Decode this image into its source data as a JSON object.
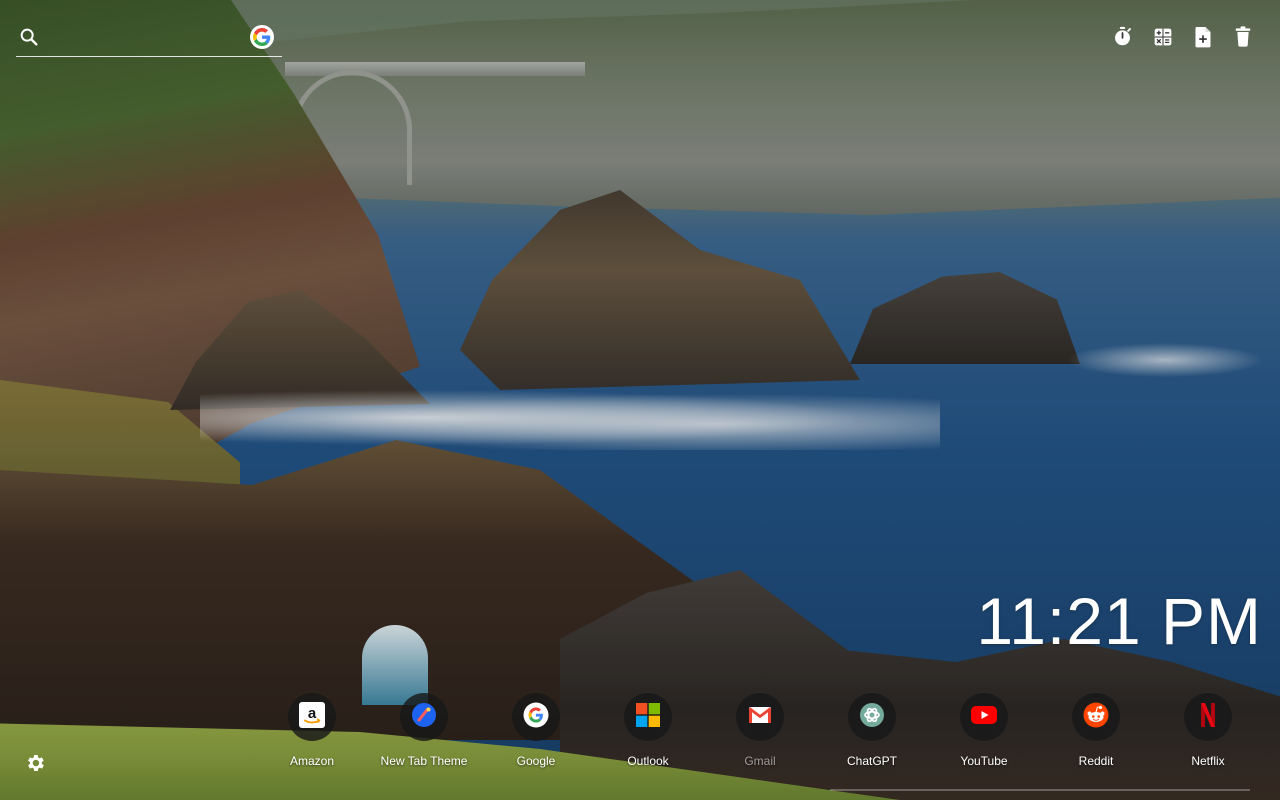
{
  "search": {
    "placeholder": "",
    "icon": "search-icon",
    "engine_icon": "google-icon"
  },
  "tools": [
    {
      "name": "timer",
      "icon": "stopwatch-icon"
    },
    {
      "name": "calculator",
      "icon": "calculator-icon"
    },
    {
      "name": "new-note",
      "icon": "note-add-icon"
    },
    {
      "name": "delete",
      "icon": "trash-icon"
    }
  ],
  "clock": {
    "time": "11:21 PM"
  },
  "shortcuts": [
    {
      "label": "Amazon",
      "icon": "amazon-icon"
    },
    {
      "label": "New Tab Theme",
      "icon": "new-tab-theme-icon"
    },
    {
      "label": "Google",
      "icon": "google-icon"
    },
    {
      "label": "Outlook",
      "icon": "microsoft-icon"
    },
    {
      "label": "Gmail",
      "icon": "gmail-icon"
    },
    {
      "label": "ChatGPT",
      "icon": "chatgpt-icon"
    },
    {
      "label": "YouTube",
      "icon": "youtube-icon"
    },
    {
      "label": "Reddit",
      "icon": "reddit-icon"
    },
    {
      "label": "Netflix",
      "icon": "netflix-icon"
    }
  ],
  "settings": {
    "icon": "gear-icon"
  },
  "colors": {
    "google_blue": "#4285F4",
    "google_red": "#EA4335",
    "google_yellow": "#FBBC05",
    "google_green": "#34A853",
    "youtube_red": "#FF0000",
    "reddit_orange": "#FF4500",
    "netflix_red": "#E50914",
    "new_tab_blue": "#1E63F0"
  }
}
